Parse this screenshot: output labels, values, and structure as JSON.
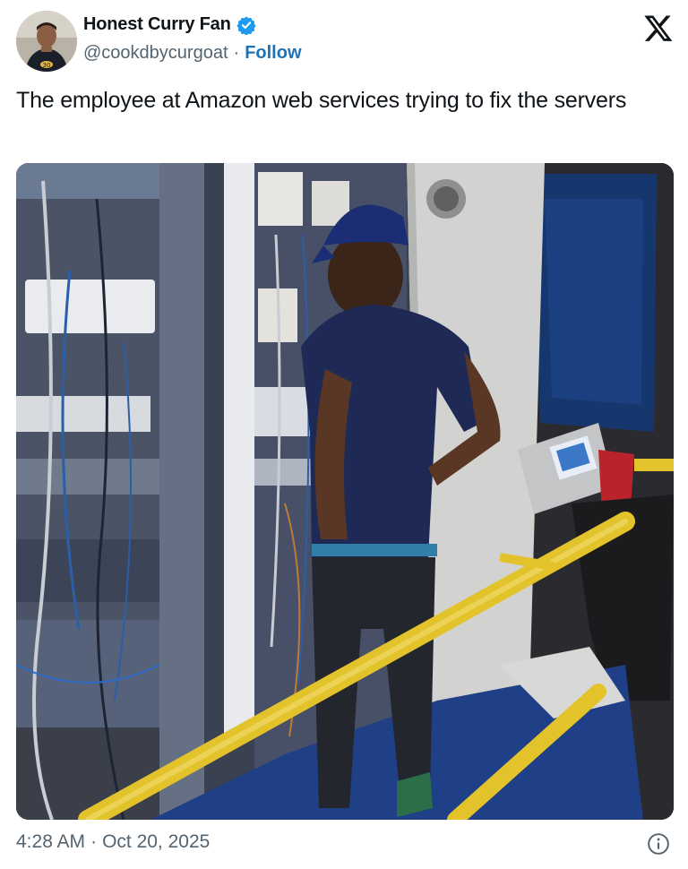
{
  "author": {
    "display_name": "Honest Curry Fan",
    "handle": "@cookdbycurgoat",
    "separator": "·",
    "follow_label": "Follow",
    "verified": true,
    "avatar_icon": "player-avatar-icon"
  },
  "brand_icon": "x-logo-icon",
  "tweet": {
    "text": "The employee at Amazon web services trying to fix the servers",
    "media_icon": "photo-man-at-server-rack"
  },
  "footer": {
    "time": "4:28 AM",
    "separator": "·",
    "date": "Oct 20, 2025",
    "info_icon": "info-icon"
  },
  "colors": {
    "link": "#1d73b8",
    "verified": "#1d9bf0",
    "secondary_text": "#536471",
    "railing": "#e3c32b"
  }
}
